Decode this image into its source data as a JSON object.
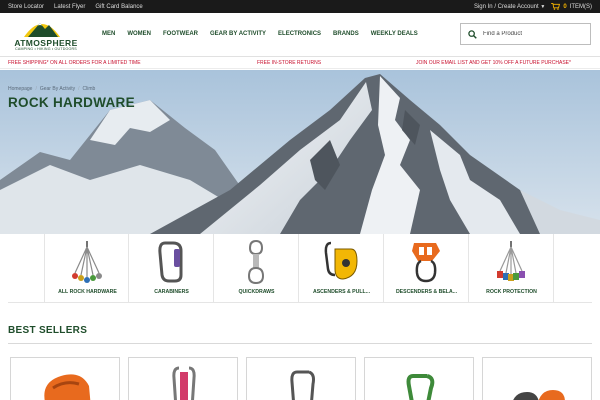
{
  "topbar": {
    "links": [
      "Store Locator",
      "Latest Flyer",
      "Gift Card Balance"
    ],
    "account": "Sign In / Create Account",
    "cart_count": "0",
    "cart_label": "ITEM(S)"
  },
  "header": {
    "logo_brand": "ATMOSPHERE",
    "logo_tagline": "CAMPING • HIKING • OUTDOORS",
    "nav": [
      "MEN",
      "WOMEN",
      "FOOTWEAR",
      "GEAR BY ACTIVITY",
      "ELECTRONICS",
      "BRANDS",
      "WEEKLY DEALS"
    ],
    "search_placeholder": "Find a Product"
  },
  "promo": {
    "left": "FREE SHIPPING* ON ALL ORDERS FOR A LIMITED TIME",
    "center": "FREE IN-STORE RETURNS",
    "right": "JOIN OUR EMAIL LIST AND GET 10% OFF A FUTURE PURCHASE*"
  },
  "breadcrumb": [
    "Homepage",
    "Gear By Activity",
    "Climb"
  ],
  "page_title": "ROCK HARDWARE",
  "categories": [
    {
      "label": "ALL ROCK HARDWARE",
      "icon": "cam-set-icon"
    },
    {
      "label": "CARABINERS",
      "icon": "carabiner-icon"
    },
    {
      "label": "QUICKDRAWS",
      "icon": "quickdraw-icon"
    },
    {
      "label": "ASCENDERS & PULL...",
      "icon": "pulley-icon"
    },
    {
      "label": "DESCENDERS & BELA...",
      "icon": "belay-device-icon"
    },
    {
      "label": "ROCK PROTECTION",
      "icon": "nut-set-icon"
    }
  ],
  "best_sellers_title": "BEST SELLERS",
  "colors": {
    "brand_green": "#1f4d2b",
    "promo_red": "#c8102e",
    "topbar_bg": "#1a1a1a",
    "cart_accent": "#f6b400",
    "logo_yellow": "#f2c80f"
  }
}
